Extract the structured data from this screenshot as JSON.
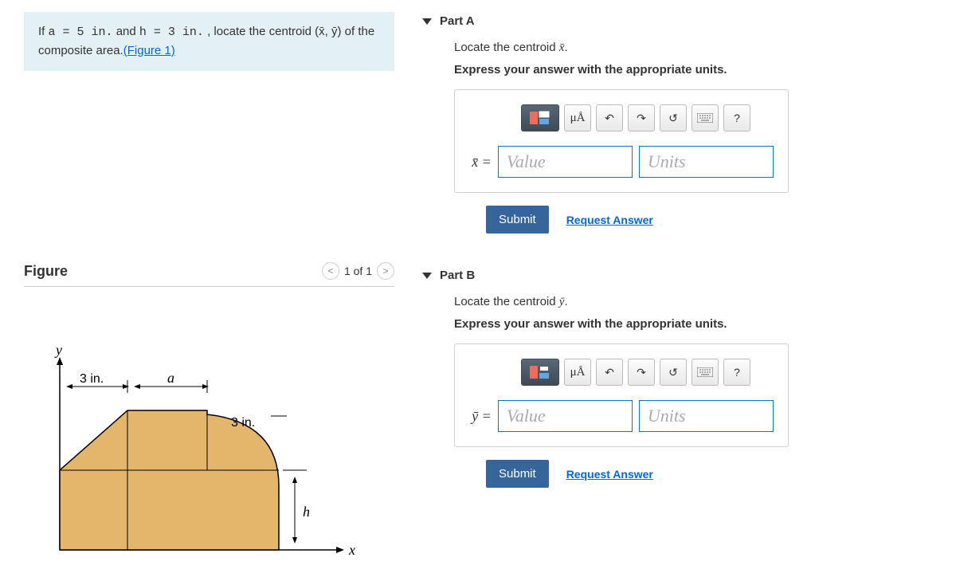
{
  "problem": {
    "prefix": "If ",
    "a_eq": "a = 5 in.",
    "and": " and ",
    "h_eq": "h = 3 in.",
    "tail": " , locate the centroid (x̄, ȳ) of the composite area.",
    "figure_link": "(Figure 1)"
  },
  "figure": {
    "title": "Figure",
    "pager": "1 of 1",
    "labels": {
      "y": "y",
      "x": "x",
      "left": "3 in.",
      "a": "a",
      "top3": "3 in.",
      "h": "h"
    }
  },
  "parts": [
    {
      "title": "Part A",
      "instr1_pre": "Locate the centroid ",
      "instr1_var": "x̄",
      "instr1_post": ".",
      "instr2": "Express your answer with the appropriate units.",
      "var_label": "x̄ =",
      "value_ph": "Value",
      "units_ph": "Units",
      "submit": "Submit",
      "request": "Request Answer",
      "units_btn": "μÅ",
      "help": "?"
    },
    {
      "title": "Part B",
      "instr1_pre": "Locate the centroid ",
      "instr1_var": "ȳ",
      "instr1_post": ".",
      "instr2": "Express your answer with the appropriate units.",
      "var_label": "ȳ =",
      "value_ph": "Value",
      "units_ph": "Units",
      "submit": "Submit",
      "request": "Request Answer",
      "units_btn": "μÅ",
      "help": "?"
    }
  ]
}
